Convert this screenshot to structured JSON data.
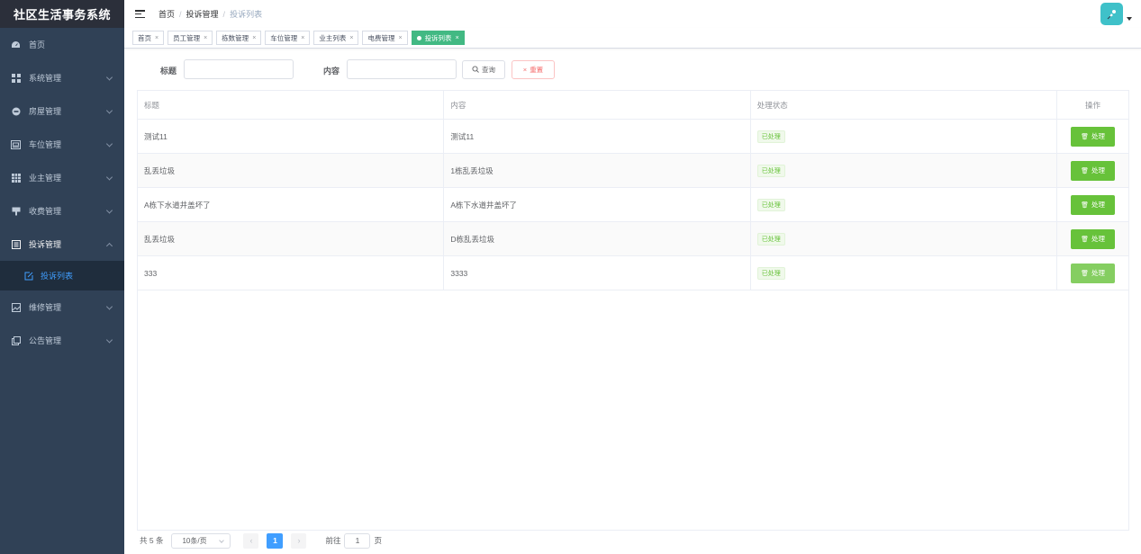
{
  "app": {
    "title": "社区生活事务系统"
  },
  "sidebar": {
    "items": [
      {
        "label": "首页",
        "icon": "dashboard-icon",
        "expandable": false
      },
      {
        "label": "系统管理",
        "icon": "grid-icon",
        "expandable": true
      },
      {
        "label": "房屋管理",
        "icon": "house-icon",
        "expandable": true
      },
      {
        "label": "车位管理",
        "icon": "car-icon",
        "expandable": true
      },
      {
        "label": "业主管理",
        "icon": "table-icon",
        "expandable": true
      },
      {
        "label": "收费管理",
        "icon": "money-icon",
        "expandable": true
      },
      {
        "label": "投诉管理",
        "icon": "complaint-icon",
        "expandable": true,
        "open": true
      },
      {
        "label": "维修管理",
        "icon": "repair-icon",
        "expandable": true
      },
      {
        "label": "公告管理",
        "icon": "notice-icon",
        "expandable": true
      }
    ],
    "submenu": {
      "label": "投诉列表",
      "icon": "edit-icon"
    }
  },
  "breadcrumb": [
    "首页",
    "投诉管理",
    "投诉列表"
  ],
  "tags": [
    {
      "label": "首页",
      "active": false
    },
    {
      "label": "员工管理",
      "active": false
    },
    {
      "label": "栋数管理",
      "active": false
    },
    {
      "label": "车位管理",
      "active": false
    },
    {
      "label": "业主列表",
      "active": false
    },
    {
      "label": "电费管理",
      "active": false
    },
    {
      "label": "投诉列表",
      "active": true
    }
  ],
  "search": {
    "title_label": "标题",
    "content_label": "内容",
    "query_button": "查询",
    "reset_button": "重置"
  },
  "table": {
    "columns": [
      "标题",
      "内容",
      "处理状态",
      "操作"
    ],
    "rows": [
      {
        "title": "测试11",
        "content": "测试11",
        "status": "已处理",
        "action": "处理"
      },
      {
        "title": "乱丢垃圾",
        "content": "1栋乱丢垃圾",
        "status": "已处理",
        "action": "处理"
      },
      {
        "title": "A栋下水道井盖坏了",
        "content": "A栋下水道井盖坏了",
        "status": "已处理",
        "action": "处理"
      },
      {
        "title": "乱丢垃圾",
        "content": "D栋乱丢垃圾",
        "status": "已处理",
        "action": "处理"
      },
      {
        "title": "333",
        "content": "3333",
        "status": "已处理",
        "action": "处理"
      }
    ]
  },
  "pagination": {
    "total": "共 5 条",
    "page_size": "10条/页",
    "current_page": "1",
    "goto_label": "前往",
    "goto_value": "1",
    "page_suffix": "页"
  },
  "colors": {
    "sidebar_bg": "#304156",
    "active_tag": "#42b983",
    "success": "#67c23a",
    "primary": "#409eff"
  }
}
